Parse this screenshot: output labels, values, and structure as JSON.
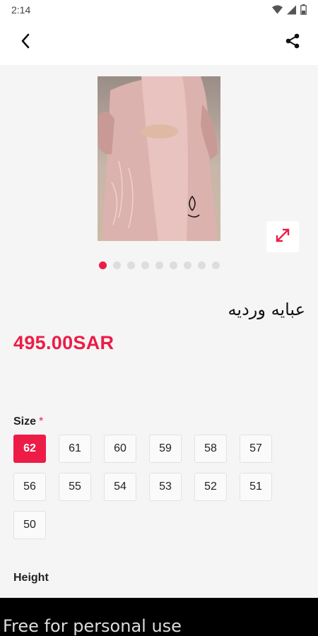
{
  "status_bar": {
    "time": "2:14",
    "icons": [
      "wifi-icon",
      "signal-icon",
      "battery-icon"
    ]
  },
  "app_bar": {
    "back_icon": "chevron-left-icon",
    "share_icon": "share-icon"
  },
  "gallery": {
    "image_count": 9,
    "active_index": 0,
    "expand_icon": "expand-arrows-icon"
  },
  "product": {
    "title": "عبايه ورديه",
    "price": "495.00SAR"
  },
  "size": {
    "label": "Size",
    "required_mark": "*",
    "options": [
      "62",
      "61",
      "60",
      "59",
      "58",
      "57",
      "56",
      "55",
      "54",
      "53",
      "52",
      "51",
      "50"
    ],
    "selected": "62"
  },
  "height": {
    "label": "Height"
  },
  "watermark": {
    "text": "Free for personal use"
  },
  "colors": {
    "accent": "#ec1c47",
    "background": "#f5f5f5"
  }
}
